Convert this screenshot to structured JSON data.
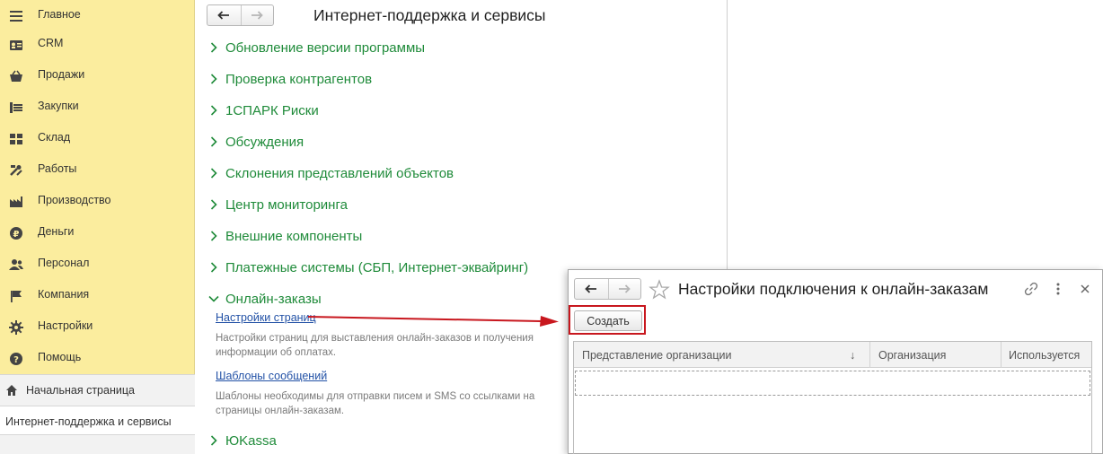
{
  "sidebar": {
    "items": [
      {
        "label": "Главное",
        "icon": "menu-icon"
      },
      {
        "label": "CRM",
        "icon": "contact-card-icon"
      },
      {
        "label": "Продажи",
        "icon": "basket-icon"
      },
      {
        "label": "Закупки",
        "icon": "cart-icon"
      },
      {
        "label": "Склад",
        "icon": "warehouse-icon"
      },
      {
        "label": "Работы",
        "icon": "tools-icon"
      },
      {
        "label": "Производство",
        "icon": "factory-icon"
      },
      {
        "label": "Деньги",
        "icon": "ruble-icon"
      },
      {
        "label": "Персонал",
        "icon": "people-icon"
      },
      {
        "label": "Компания",
        "icon": "flag-icon"
      },
      {
        "label": "Настройки",
        "icon": "gear-icon"
      },
      {
        "label": "Помощь",
        "icon": "help-icon"
      }
    ],
    "home_label": "Начальная страница",
    "open_window_label": "Интернет-поддержка и сервисы"
  },
  "main": {
    "title": "Интернет-поддержка и сервисы",
    "sections": [
      {
        "label": "Обновление версии программы",
        "expanded": false
      },
      {
        "label": "Проверка контрагентов",
        "expanded": false
      },
      {
        "label": "1СПАРК Риски",
        "expanded": false
      },
      {
        "label": "Обсуждения",
        "expanded": false
      },
      {
        "label": "Склонения представлений объектов",
        "expanded": false
      },
      {
        "label": "Центр мониторинга",
        "expanded": false
      },
      {
        "label": "Внешние компоненты",
        "expanded": false
      },
      {
        "label": "Платежные системы (СБП, Интернет-эквайринг)",
        "expanded": false
      },
      {
        "label": "Онлайн-заказы",
        "expanded": true
      },
      {
        "label": "ЮKassa",
        "expanded": false
      }
    ],
    "online_orders": {
      "link1": "Настройки страниц",
      "desc1": "Настройки страниц для выставления онлайн-заказов и получения информации об оплатах.",
      "link2": "Шаблоны сообщений",
      "desc2": "Шаблоны необходимы для отправки писем и SMS со ссылками на страницы онлайн-заказам."
    }
  },
  "dialog": {
    "title": "Настройки подключения к онлайн-заказам",
    "create_button": "Создать",
    "columns": [
      "Представление организации",
      "Организация",
      "Используется"
    ],
    "sort_indicator": "↓"
  },
  "colors": {
    "sidebar_bg": "#fbed9e",
    "section_green": "#1f8b3a",
    "link_blue": "#2251a6",
    "highlight_red": "#c8171e"
  }
}
